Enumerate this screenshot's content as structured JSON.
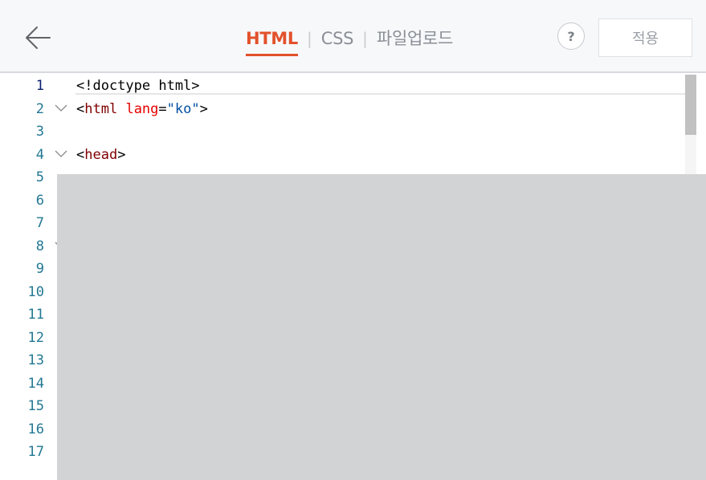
{
  "header": {
    "back_icon": "arrow-left-icon",
    "tabs": [
      {
        "label": "HTML",
        "active": true
      },
      {
        "label": "CSS",
        "active": false
      },
      {
        "label": "파일업로드",
        "active": false
      }
    ],
    "separator": "|",
    "help_label": "?",
    "apply_label": "적용"
  },
  "editor": {
    "lines": [
      {
        "number": "1",
        "tokens": [
          {
            "t": "<!doctype html>",
            "c": "punct"
          }
        ]
      },
      {
        "number": "2",
        "fold": true,
        "tokens": [
          {
            "t": "<",
            "c": "punct"
          },
          {
            "t": "html",
            "c": "tag"
          },
          {
            "t": " ",
            "c": "punct"
          },
          {
            "t": "lang",
            "c": "attr"
          },
          {
            "t": "=",
            "c": "punct"
          },
          {
            "t": "\"ko\"",
            "c": "str"
          },
          {
            "t": ">",
            "c": "punct"
          }
        ]
      },
      {
        "number": "3",
        "tokens": []
      },
      {
        "number": "4",
        "fold": true,
        "tokens": [
          {
            "t": "<",
            "c": "punct"
          },
          {
            "t": "head",
            "c": "tag"
          },
          {
            "t": ">",
            "c": "punct"
          }
        ]
      },
      {
        "number": "5",
        "tokens": []
      },
      {
        "number": "6",
        "tokens": []
      },
      {
        "number": "7",
        "tokens": []
      },
      {
        "number": "8",
        "fold": true,
        "tokens": []
      },
      {
        "number": "9",
        "tokens": []
      },
      {
        "number": "10",
        "tokens": []
      },
      {
        "number": "11",
        "tokens": []
      },
      {
        "number": "12",
        "tokens": []
      },
      {
        "number": "13",
        "tokens": []
      },
      {
        "number": "14",
        "tokens": []
      },
      {
        "number": "15",
        "tokens": []
      },
      {
        "number": "16",
        "tokens": []
      },
      {
        "number": "17",
        "tokens": []
      }
    ]
  },
  "colors": {
    "accent": "#e2512b",
    "tag": "#800000",
    "attribute": "#e50000",
    "string": "#0451a5",
    "line_number": "#237893",
    "overlay": "#d2d3d5"
  }
}
